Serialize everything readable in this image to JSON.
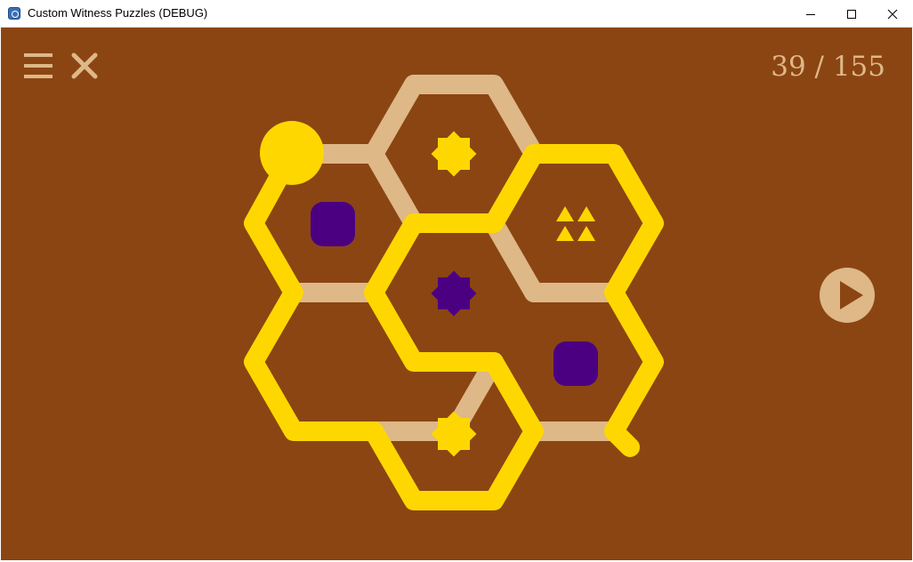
{
  "window": {
    "title": "Custom Witness Puzzles (DEBUG)",
    "app_icon": "app-icon",
    "controls": [
      "minimize-icon",
      "maximize-icon",
      "close-icon"
    ]
  },
  "game": {
    "background_color": "#8b4513",
    "hud": {
      "menu_icon": "hamburger-menu-icon",
      "close_icon": "close-x-icon",
      "play_icon": "play-icon",
      "puzzle_counter": "39 / 155"
    },
    "colors": {
      "grid_line": "#deb887",
      "solution_path": "#ffd700",
      "symbol_yellow": "#ffd700",
      "symbol_purple": "#4b0082",
      "ui_tan": "#deb887"
    },
    "puzzle": {
      "grid_type": "hexagonal",
      "cells": [
        {
          "id": "top",
          "symbol": "star",
          "color": "yellow"
        },
        {
          "id": "upper-left",
          "symbol": "square",
          "color": "purple"
        },
        {
          "id": "upper-right",
          "symbol": "triangles",
          "count": 4,
          "color": "yellow"
        },
        {
          "id": "center",
          "symbol": "star",
          "color": "purple"
        },
        {
          "id": "lower-left",
          "symbol": "none"
        },
        {
          "id": "lower-right",
          "symbol": "square",
          "color": "purple"
        },
        {
          "id": "bottom",
          "symbol": "star",
          "color": "yellow"
        }
      ],
      "solved_path_drawn": true
    }
  }
}
